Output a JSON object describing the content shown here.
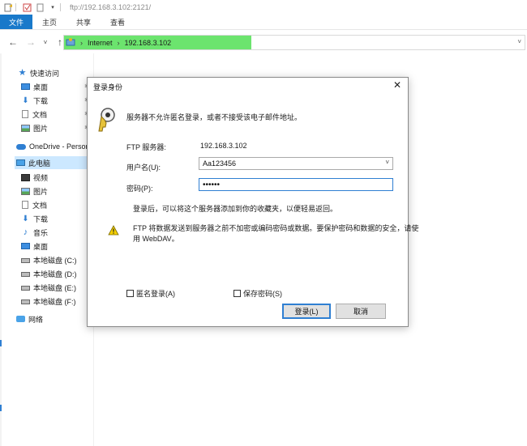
{
  "window": {
    "title_path": "ftp://192.168.3.102:2121/"
  },
  "ribbon": {
    "tabs": [
      "文件",
      "主页",
      "共享",
      "查看"
    ]
  },
  "address": {
    "crumbs": [
      "Internet",
      "192.168.3.102"
    ],
    "highlight_color": "#6ce46e"
  },
  "sidebar": {
    "quick_access": "快速访问",
    "quick_items": [
      "桌面",
      "下载",
      "文档",
      "图片"
    ],
    "onedrive": "OneDrive - Persor",
    "this_pc": "此电脑",
    "pc_items": [
      "视频",
      "图片",
      "文档",
      "下载",
      "音乐",
      "桌面",
      "本地磁盘 (C:)",
      "本地磁盘 (D:)",
      "本地磁盘 (E:)",
      "本地磁盘 (F:)"
    ],
    "network": "网络"
  },
  "dialog": {
    "title": "登录身份",
    "info": "服务器不允许匿名登录，或者不接受该电子邮件地址。",
    "ftp_server_label": "FTP 服务器:",
    "ftp_server_value": "192.168.3.102",
    "username_label": "用户名(U):",
    "username_value": "Aa123456",
    "password_label": "密码(P):",
    "password_value": "••••••",
    "after_login_note": "登录后，可以将这个服务器添加到你的收藏夹，以便轻易返回。",
    "warning_line1": "FTP 将数据发送到服务器之前不加密或编码密码或数据。要保护密码和数据的安全，请使",
    "warning_line2": "用 WebDAV。",
    "anonymous_label": "匿名登录(A)",
    "save_password_label": "保存密码(S)",
    "login_button": "登录(L)",
    "cancel_button": "取消"
  },
  "colors": {
    "accent": "#1979ca",
    "selection": "#cce8ff"
  }
}
